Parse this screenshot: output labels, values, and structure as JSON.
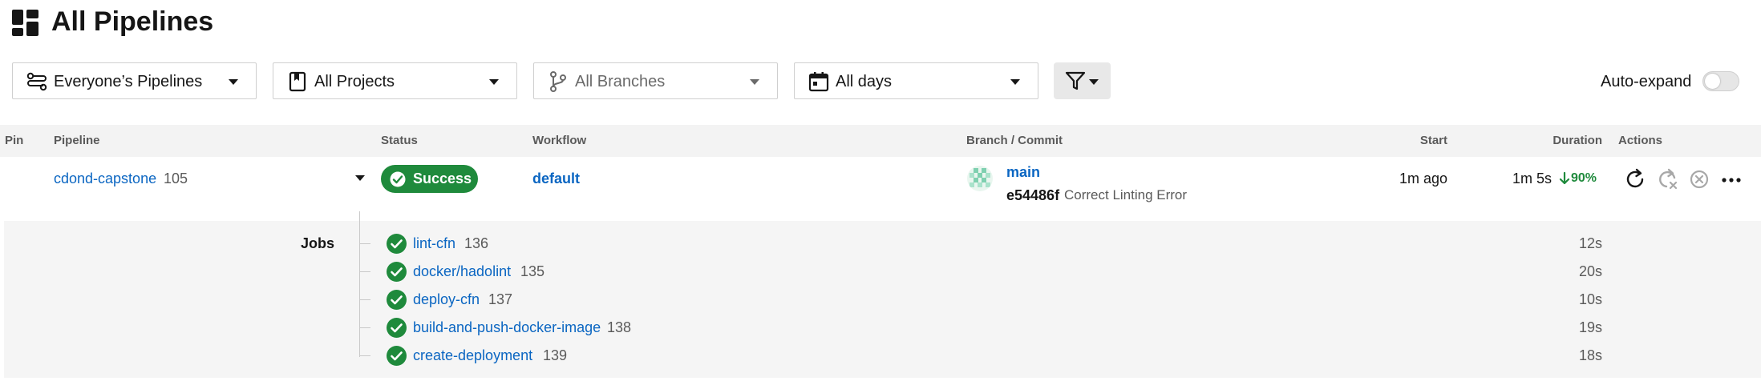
{
  "header": {
    "title": "All Pipelines",
    "icon": "dashboard-icon"
  },
  "filters": {
    "pipelines": "Everyone’s Pipelines",
    "projects": "All Projects",
    "branches": "All Branches",
    "days": "All days",
    "auto_expand_label": "Auto-expand",
    "auto_expand_on": false
  },
  "table": {
    "headers": {
      "pin": "Pin",
      "pipeline": "Pipeline",
      "status": "Status",
      "workflow": "Workflow",
      "branch_commit": "Branch / Commit",
      "start": "Start",
      "duration": "Duration",
      "actions": "Actions"
    },
    "pipeline": {
      "name": "cdond-capstone",
      "number": "105",
      "status": "Success",
      "workflow": "default",
      "branch": "main",
      "commit_sha": "e54486f",
      "commit_message": "Correct Linting Error",
      "start": "1m ago",
      "duration": "1m 5s",
      "trend": "90%"
    },
    "jobs_label": "Jobs",
    "jobs": [
      {
        "name": "lint-cfn",
        "number": "136",
        "duration": "12s"
      },
      {
        "name": "docker/hadolint",
        "number": "135",
        "duration": "20s"
      },
      {
        "name": "deploy-cfn",
        "number": "137",
        "duration": "10s"
      },
      {
        "name": "build-and-push-docker-image",
        "number": "138",
        "duration": "19s"
      },
      {
        "name": "create-deployment",
        "number": "139",
        "duration": "18s"
      }
    ]
  },
  "colors": {
    "success": "#1f8a3c",
    "link": "#0b66c2",
    "header_bg": "#f3f3f3",
    "jobs_bg": "#f5f5f5"
  }
}
